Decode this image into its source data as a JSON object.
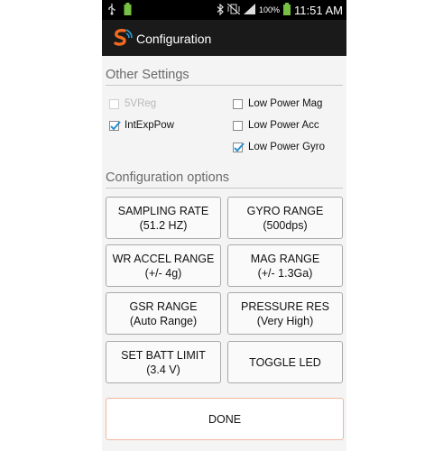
{
  "status_bar": {
    "battery_percent": "100%",
    "time": "11:51 AM"
  },
  "action_bar": {
    "title": "Configuration"
  },
  "other_settings": {
    "header": "Other Settings",
    "checkboxes": [
      {
        "label": "5VReg",
        "checked": false,
        "enabled": false
      },
      {
        "label": "IntExpPow",
        "checked": true,
        "enabled": true
      },
      {
        "label": "Low Power Mag",
        "checked": false,
        "enabled": true
      },
      {
        "label": "Low Power Acc",
        "checked": false,
        "enabled": true
      },
      {
        "label": "Low Power Gyro",
        "checked": true,
        "enabled": true
      }
    ]
  },
  "config_options": {
    "header": "Configuration options",
    "buttons": [
      {
        "line1": "SAMPLING RATE",
        "line2": "(51.2 HZ)"
      },
      {
        "line1": "GYRO RANGE",
        "line2": "(500dps)"
      },
      {
        "line1": "WR ACCEL RANGE",
        "line2": "(+/- 4g)"
      },
      {
        "line1": "MAG RANGE",
        "line2": "(+/- 1.3Ga)"
      },
      {
        "line1": "GSR RANGE",
        "line2": "(Auto Range)"
      },
      {
        "line1": "PRESSURE RES",
        "line2": "(Very High)"
      },
      {
        "line1": "SET BATT LIMIT",
        "line2": "(3.4 V)"
      },
      {
        "line1": "TOGGLE LED",
        "line2": ""
      }
    ],
    "done_label": "DONE"
  },
  "colors": {
    "accent_check": "#2a8fd4",
    "done_border": "#f0b79c",
    "battery": "#76c043",
    "logo_orange": "#f26b21",
    "logo_blue": "#2aa7e0"
  }
}
